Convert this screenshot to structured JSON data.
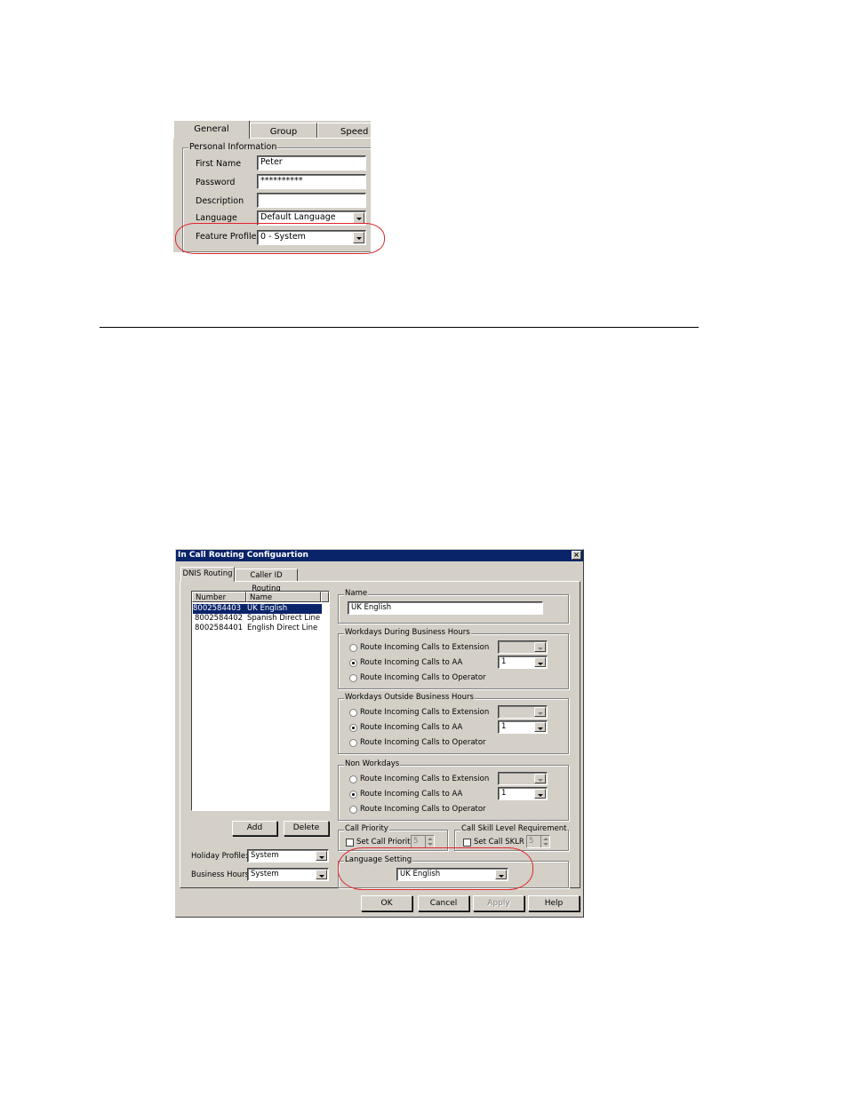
{
  "user_dialog": {
    "tabs": [
      "General",
      "Group",
      "Speed D"
    ],
    "group_title": "Personal Information",
    "fields": {
      "first_name": {
        "label": "First Name",
        "value": "Peter"
      },
      "password": {
        "label": "Password",
        "value": "**********"
      },
      "description": {
        "label": "Description",
        "value": ""
      },
      "language": {
        "label": "Language",
        "value": "Default Language"
      },
      "feature_profile": {
        "label": "Feature Profile",
        "value": "0 - System"
      }
    }
  },
  "routing_dialog": {
    "title": "In Call Routing Configuartion",
    "close_label": "×",
    "tabs": [
      "DNIS Routing",
      "Caller ID Routing"
    ],
    "list": {
      "columns": [
        "Number",
        "Name"
      ],
      "rows": [
        {
          "number": "8002584403",
          "name": "UK English",
          "selected": true
        },
        {
          "number": "8002584402",
          "name": "Spanish Direct Line",
          "selected": false
        },
        {
          "number": "8002584401",
          "name": "English Direct Line",
          "selected": false
        }
      ]
    },
    "buttons": {
      "add": "Add",
      "delete": "Delete",
      "ok": "OK",
      "cancel": "Cancel",
      "apply": "Apply",
      "help": "Help"
    },
    "holiday_profile": {
      "label": "Holiday Profile:",
      "value": "System"
    },
    "business_hours": {
      "label": "Business Hours:",
      "value": "System"
    },
    "name_group": {
      "title": "Name",
      "value": "UK English"
    },
    "schedules": [
      {
        "title": "Workdays During Business Hours",
        "options": [
          "Route Incoming Calls to Extension",
          "Route Incoming Calls to AA",
          "Route Incoming Calls to Operator"
        ],
        "selected": 1,
        "aa_value": "1"
      },
      {
        "title": "Workdays Outside Business Hours",
        "options": [
          "Route Incoming Calls to Extension",
          "Route Incoming Calls to AA",
          "Route Incoming Calls to Operator"
        ],
        "selected": 1,
        "aa_value": "1"
      },
      {
        "title": "Non Workdays",
        "options": [
          "Route Incoming Calls to Extension",
          "Route Incoming Calls to AA",
          "Route Incoming Calls to Operator"
        ],
        "selected": 1,
        "aa_value": "1"
      }
    ],
    "call_priority": {
      "title": "Call Priority",
      "checkbox_label": "Set Call Priority",
      "checked": false,
      "value": "5"
    },
    "call_skill": {
      "title": "Call Skill Level Requirement",
      "checkbox_label": "Set Call SKLR",
      "checked": false,
      "value": "5"
    },
    "language_setting": {
      "title": "Language Setting",
      "value": "UK English"
    }
  },
  "colors": {
    "highlight": "#e0262b",
    "titlebar": "#0a246a",
    "dialog_face": "#d4d0c8"
  }
}
